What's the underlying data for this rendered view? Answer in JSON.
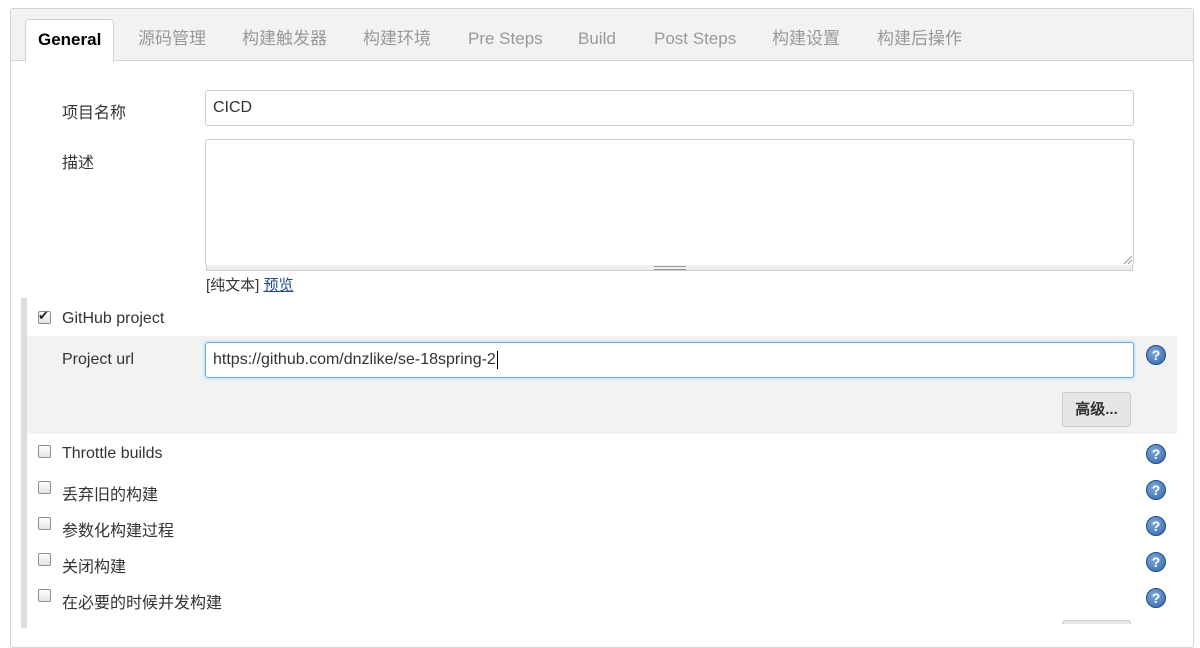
{
  "tabs": [
    {
      "label": "General",
      "active": true
    },
    {
      "label": "源码管理"
    },
    {
      "label": "构建触发器"
    },
    {
      "label": "构建环境"
    },
    {
      "label": "Pre Steps"
    },
    {
      "label": "Build"
    },
    {
      "label": "Post Steps"
    },
    {
      "label": "构建设置"
    },
    {
      "label": "构建后操作"
    }
  ],
  "project_name": {
    "label": "项目名称",
    "value": "CICD"
  },
  "description": {
    "label": "描述",
    "value": "",
    "plain_text": "[纯文本]",
    "preview": "预览"
  },
  "github_project": {
    "label": "GitHub project",
    "checked": true,
    "url_label": "Project url",
    "url_value": "https://github.com/dnzlike/se-18spring-2",
    "advanced_button": "高级..."
  },
  "options": [
    {
      "label": "Throttle builds",
      "checked": false
    },
    {
      "label": "丢弃旧的构建",
      "checked": false
    },
    {
      "label": "参数化构建过程",
      "checked": false
    },
    {
      "label": "关闭构建",
      "checked": false
    },
    {
      "label": "在必要的时候并发构建",
      "checked": false
    }
  ],
  "icons": {
    "help": "help-icon",
    "checkmark": "✔",
    "help_glyph": "?"
  },
  "colors": {
    "link": "#204a87",
    "focus_border": "#66afe9",
    "help_blue": "#2e65a8"
  }
}
